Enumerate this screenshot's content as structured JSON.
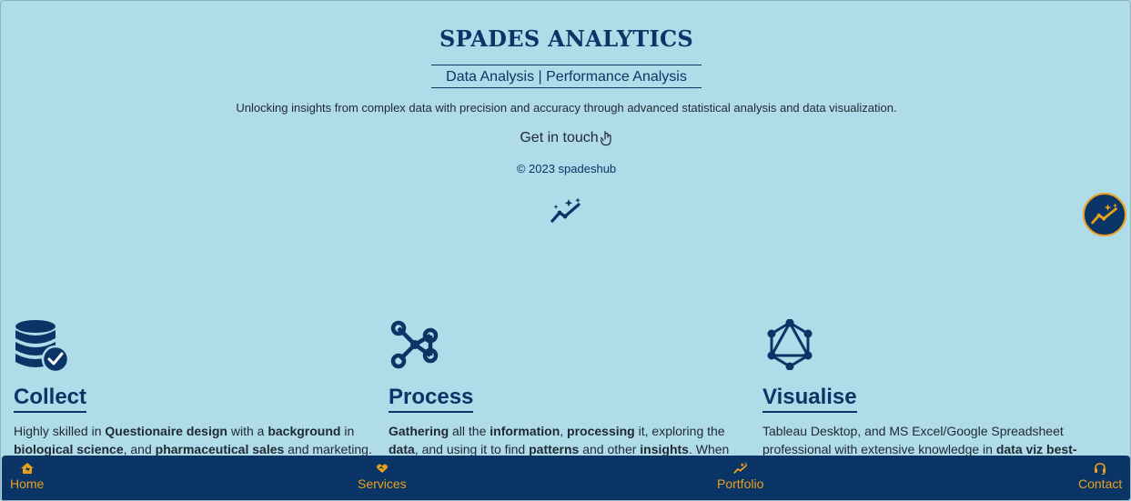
{
  "header": {
    "brand": "SPADES ANALYTICS",
    "subtitle": "Data Analysis | Performance Analysis",
    "tagline": "Unlocking insights from complex data with precision and accuracy through advanced statistical analysis and data visualization.",
    "cta_label": "Get in touch",
    "cta_icon": "pointer-hand-icon",
    "copyright": "© 2023 spadeshub",
    "hero_icon": "sparkle-chart-icon"
  },
  "floating_button": {
    "icon": "sparkle-chart-icon"
  },
  "services": [
    {
      "icon": "database-check-icon",
      "title": "Collect",
      "line1": [
        {
          "t": "Highly skilled in ",
          "b": false
        },
        {
          "t": "Questionaire design",
          "b": true
        },
        {
          "t": " with a ",
          "b": false
        },
        {
          "t": "background",
          "b": true
        },
        {
          "t": " in",
          "b": false
        }
      ],
      "line2": [
        {
          "t": "biological science",
          "b": true
        },
        {
          "t": ", and ",
          "b": false
        },
        {
          "t": "pharmaceutical sales",
          "b": true
        },
        {
          "t": " and marketing. I",
          "b": false
        }
      ]
    },
    {
      "icon": "network-nodes-icon",
      "title": "Process",
      "line1": [
        {
          "t": "Gathering",
          "b": true
        },
        {
          "t": " all the ",
          "b": false
        },
        {
          "t": "information",
          "b": true
        },
        {
          "t": ", ",
          "b": false
        },
        {
          "t": "processing",
          "b": true
        },
        {
          "t": " it, exploring the",
          "b": false
        }
      ],
      "line2": [
        {
          "t": "data",
          "b": true
        },
        {
          "t": ", and using it to find ",
          "b": false
        },
        {
          "t": "patterns",
          "b": true
        },
        {
          "t": " and other ",
          "b": false
        },
        {
          "t": "insights",
          "b": true
        },
        {
          "t": ". When",
          "b": false
        }
      ]
    },
    {
      "icon": "graph-network-icon",
      "title": "Visualise",
      "line1": [
        {
          "t": "Tableau Desktop, and MS Excel/Google Spreadsheet",
          "b": false
        }
      ],
      "line2": [
        {
          "t": "professional with extensive knowledge in ",
          "b": false
        },
        {
          "t": "data viz best-",
          "b": true
        }
      ]
    }
  ],
  "nav": [
    {
      "label": "Home",
      "icon": "home-icon"
    },
    {
      "label": "Services",
      "icon": "handshake-heart-icon"
    },
    {
      "label": "Portfolio",
      "icon": "sparkle-chart-icon"
    },
    {
      "label": "Contact",
      "icon": "headset-icon"
    }
  ],
  "colors": {
    "background": "#b0dbe8",
    "primary": "#0b3566",
    "accent": "#e9a11c",
    "text": "#1f2933"
  }
}
